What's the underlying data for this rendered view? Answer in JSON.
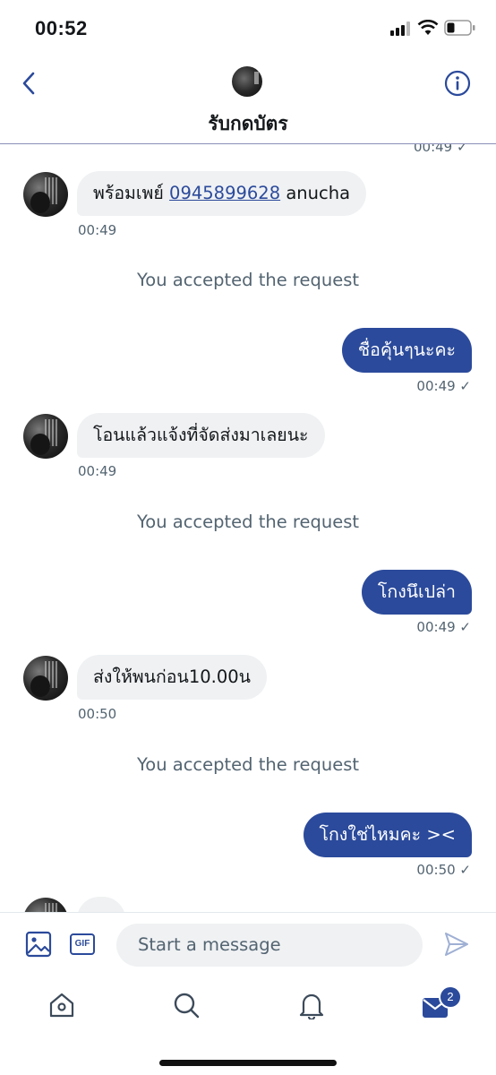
{
  "status_bar": {
    "time": "00:52"
  },
  "header": {
    "title": "รับกดบัตร"
  },
  "peek_timestamp": "00:49 ✓",
  "messages": [
    {
      "kind": "in",
      "text_before": "พร้อมเพย์ ",
      "link": "0945899628",
      "text_after": " anucha",
      "time": "00:49"
    },
    {
      "kind": "system",
      "text": "You accepted the request"
    },
    {
      "kind": "out",
      "text": "ชื่อคุ้นๆนะคะ",
      "time": "00:49 ✓"
    },
    {
      "kind": "in",
      "text": "โอนแล้วแจ้งที่จัดส่งมาเลยนะ",
      "time": "00:49"
    },
    {
      "kind": "system",
      "text": "You accepted the request"
    },
    {
      "kind": "out",
      "text": "โกงนึเปล่า",
      "time": "00:49 ✓"
    },
    {
      "kind": "in",
      "text": "ส่งให้พนก่อน10.00น",
      "time": "00:50"
    },
    {
      "kind": "system",
      "text": "You accepted the request"
    },
    {
      "kind": "out",
      "text": "โกงใช่ไหมคะ ><",
      "time": "00:50 ✓"
    }
  ],
  "composer": {
    "gif_label": "GIF",
    "placeholder": "Start a message"
  },
  "tabbar": {
    "messages_badge": "2"
  },
  "colors": {
    "accent": "#2b4a9b",
    "bubble_in": "#eff1f3",
    "muted": "#536471"
  },
  "icons": [
    "back-chevron-icon",
    "info-icon",
    "image-icon",
    "gif-icon",
    "send-icon",
    "home-icon",
    "search-icon",
    "bell-icon",
    "mail-icon"
  ]
}
